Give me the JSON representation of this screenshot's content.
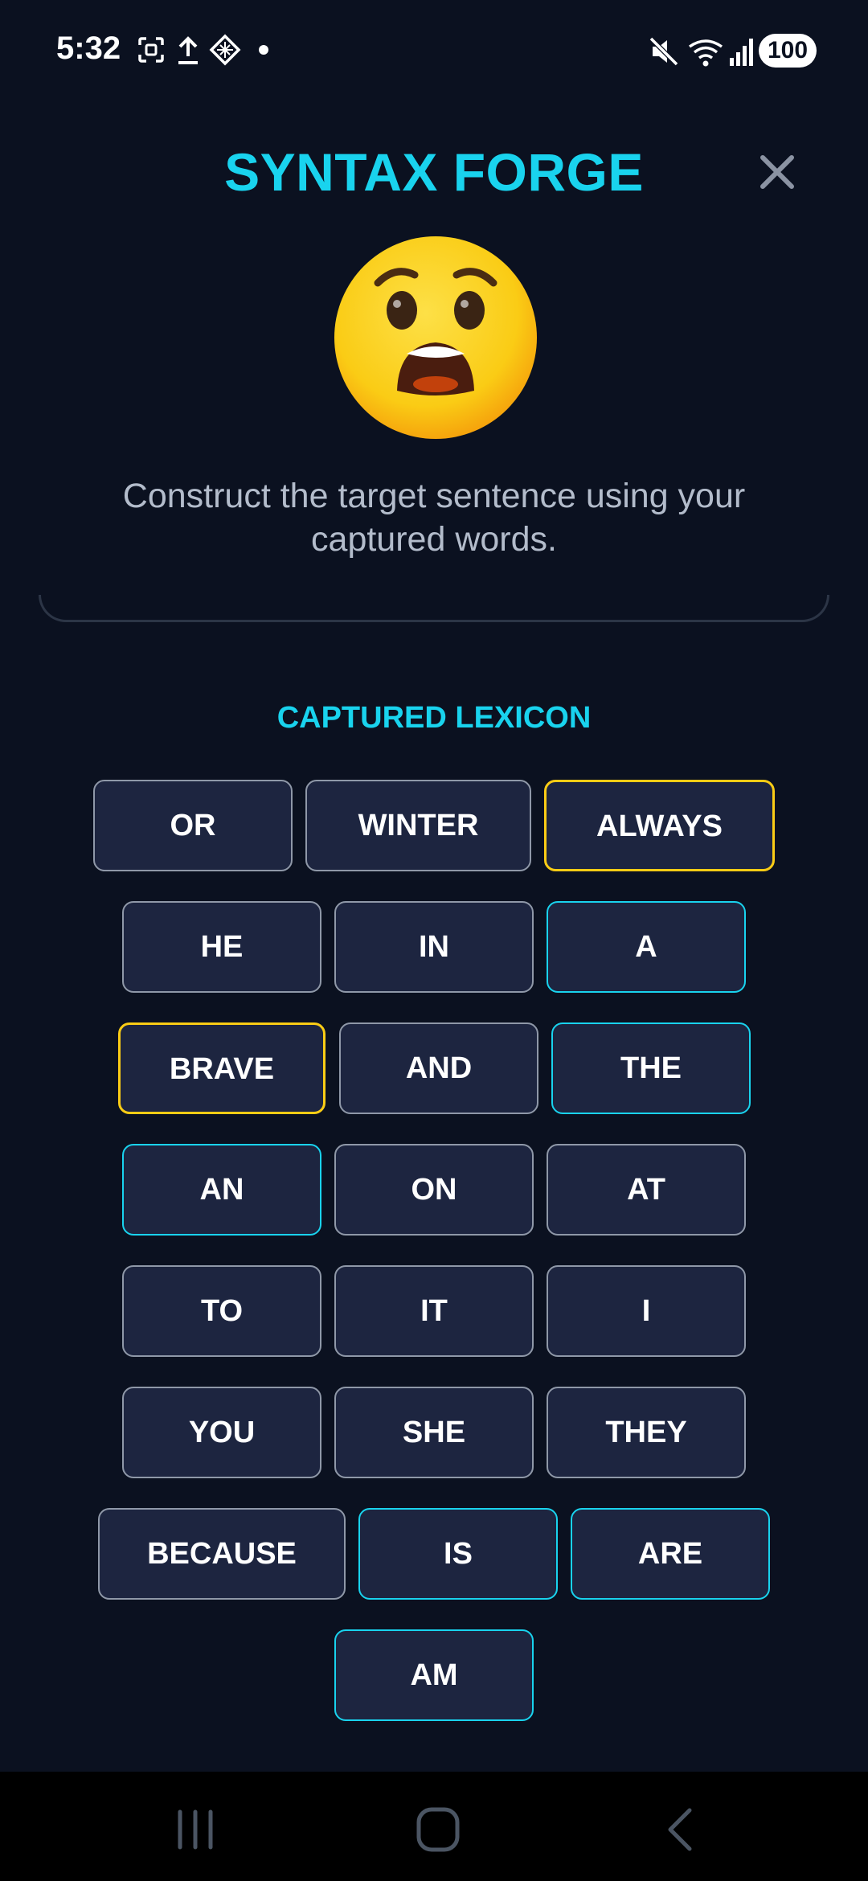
{
  "status_bar": {
    "time": "5:32",
    "battery": "100",
    "icons": [
      "screenshot-icon",
      "upload-icon",
      "app-icon",
      "dot-icon",
      "mute-icon",
      "wifi-icon",
      "signal-icon"
    ]
  },
  "header": {
    "title": "SYNTAX FORGE",
    "close_icon": "close-icon",
    "emoji": "anguished-face"
  },
  "instruction": "Construct the target sentence using your captured words.",
  "lexicon": {
    "title": "CAPTURED LEXICON",
    "words": [
      {
        "label": "OR",
        "highlight": "none"
      },
      {
        "label": "WINTER",
        "highlight": "none"
      },
      {
        "label": "ALWAYS",
        "highlight": "yellow"
      },
      {
        "label": "HE",
        "highlight": "none"
      },
      {
        "label": "IN",
        "highlight": "none"
      },
      {
        "label": "A",
        "highlight": "cyan"
      },
      {
        "label": "BRAVE",
        "highlight": "yellow"
      },
      {
        "label": "AND",
        "highlight": "none"
      },
      {
        "label": "THE",
        "highlight": "cyan"
      },
      {
        "label": "AN",
        "highlight": "cyan"
      },
      {
        "label": "ON",
        "highlight": "none"
      },
      {
        "label": "AT",
        "highlight": "none"
      },
      {
        "label": "TO",
        "highlight": "none"
      },
      {
        "label": "IT",
        "highlight": "none"
      },
      {
        "label": "I",
        "highlight": "none"
      },
      {
        "label": "YOU",
        "highlight": "none"
      },
      {
        "label": "SHE",
        "highlight": "none"
      },
      {
        "label": "THEY",
        "highlight": "none"
      },
      {
        "label": "BECAUSE",
        "highlight": "none"
      },
      {
        "label": "IS",
        "highlight": "cyan"
      },
      {
        "label": "ARE",
        "highlight": "cyan"
      },
      {
        "label": "AM",
        "highlight": "cyan"
      }
    ]
  },
  "colors": {
    "background": "#0b1120",
    "accent": "#19d3ee",
    "tile_bg": "#1d2540",
    "tile_border": "#8f98a8",
    "highlight_yellow": "#facc15",
    "highlight_cyan": "#19d3ee"
  },
  "nav": {
    "icons": [
      "recent-apps-icon",
      "home-icon",
      "back-icon"
    ]
  }
}
